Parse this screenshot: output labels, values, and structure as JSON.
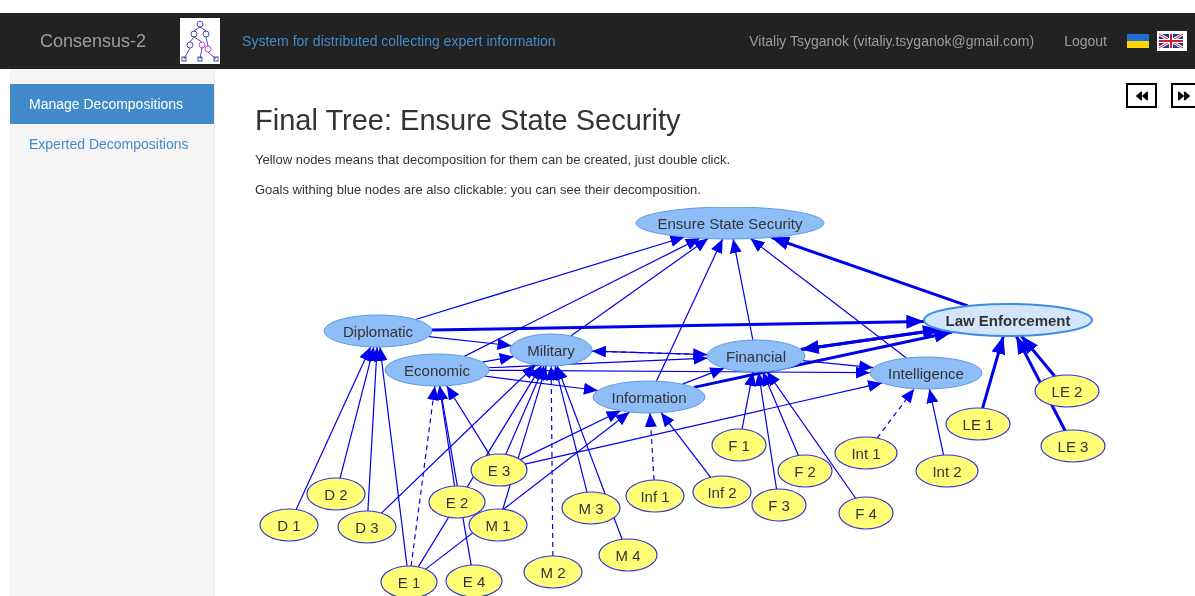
{
  "header": {
    "brand": "Consensus-2",
    "tagline": "System for distributed collecting expert information",
    "user": "Vitaliy Tsyganok (vitaliy.tsyganok@gmail.com)",
    "logout": "Logout"
  },
  "sidebar": {
    "items": [
      {
        "label": "Manage Decompositions",
        "selected": true
      },
      {
        "label": "Experted Decompositions",
        "selected": false
      }
    ]
  },
  "page": {
    "title": "Final Tree: Ensure State Security",
    "notes": [
      "Yellow nodes means that decomposition for them can be created, just double click.",
      "Goals withing blue nodes are also clickable: you can see their decomposition."
    ]
  },
  "graph": {
    "nodes": [
      {
        "label": "Ensure State Security",
        "kind": "goal"
      },
      {
        "label": "Law Enforcement",
        "kind": "focus"
      },
      {
        "label": "Diplomatic",
        "kind": "goal"
      },
      {
        "label": "Military",
        "kind": "goal"
      },
      {
        "label": "Financial",
        "kind": "goal"
      },
      {
        "label": "Economic",
        "kind": "goal"
      },
      {
        "label": "Intelligence",
        "kind": "goal"
      },
      {
        "label": "LE 2",
        "kind": "leaf"
      },
      {
        "label": "Information",
        "kind": "goal"
      },
      {
        "label": "LE 1",
        "kind": "leaf"
      },
      {
        "label": "F 1",
        "kind": "leaf"
      },
      {
        "label": "Int 1",
        "kind": "leaf"
      },
      {
        "label": "LE 3",
        "kind": "leaf"
      },
      {
        "label": "E 3",
        "kind": "leaf"
      },
      {
        "label": "F 2",
        "kind": "leaf"
      },
      {
        "label": "Int 2",
        "kind": "leaf"
      },
      {
        "label": "D 2",
        "kind": "leaf"
      },
      {
        "label": "Inf 1",
        "kind": "leaf"
      },
      {
        "label": "Inf 2",
        "kind": "leaf"
      },
      {
        "label": "E 2",
        "kind": "leaf"
      },
      {
        "label": "M 3",
        "kind": "leaf"
      },
      {
        "label": "F 3",
        "kind": "leaf"
      },
      {
        "label": "F 4",
        "kind": "leaf"
      },
      {
        "label": "D 1",
        "kind": "leaf"
      },
      {
        "label": "D 3",
        "kind": "leaf"
      },
      {
        "label": "M 1",
        "kind": "leaf"
      },
      {
        "label": "M 4",
        "kind": "leaf"
      },
      {
        "label": "M 2",
        "kind": "leaf"
      },
      {
        "label": "E 1",
        "kind": "leaf"
      },
      {
        "label": "E 4",
        "kind": "leaf"
      }
    ]
  }
}
